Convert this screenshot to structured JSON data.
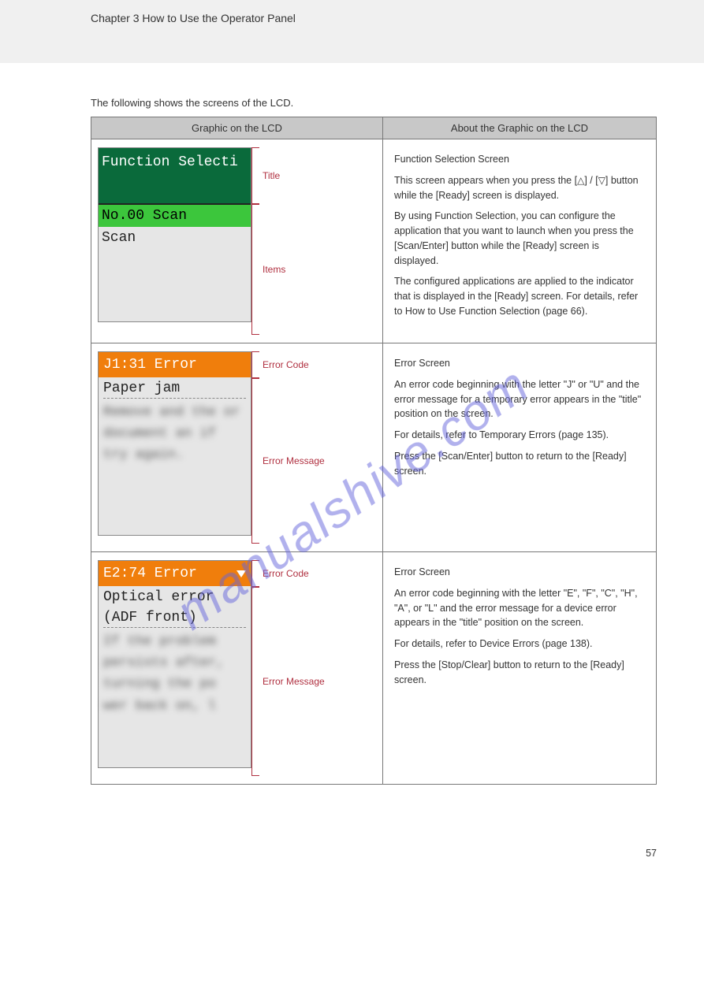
{
  "header_line": "Chapter 3 How to Use the Operator Panel",
  "intro": "The following shows the screens of the LCD.",
  "table": {
    "col1": "Graphic on the LCD",
    "col2": "About the Graphic on the LCD"
  },
  "row1": {
    "title_text": "Function Selecti",
    "selected": "No.00 Scan",
    "body": "Scan",
    "label_title": "Title",
    "label_items": "Items",
    "desc1": "Function Selection Screen",
    "desc2_a": "This screen appears when you press the [",
    "desc2_b": "] / [",
    "desc2_c": "] button while the [Ready] screen is displayed.",
    "desc3": "By using Function Selection, you can configure the application that you want to launch when you press the [Scan/Enter] button while the [Ready] screen is displayed.",
    "desc4_a": "The configured applications are applied to the indicator that is displayed in the [Ready] screen. For details, refer to ",
    "desc4_link": "How to Use Function Selection (page 66)",
    "desc4_b": ".",
    "arrow_up": "△",
    "arrow_down": "▽"
  },
  "row2": {
    "code": "J1:31 Error",
    "msg_head": "Paper jam",
    "blurred": "Remove and the or document an if try again.",
    "label_code": "Error Code",
    "label_msg": "Error Message",
    "desc1": "Error Screen",
    "desc2": "An error code beginning with the letter \"J\" or \"U\" and the error message for a temporary error appears in the \"title\" position on the screen.",
    "desc3_a": "For details, refer to ",
    "desc3_link": "Temporary Errors (page 135)",
    "desc3_b": ".",
    "desc4": "Press the [Scan/Enter] button to return to the [Ready] screen."
  },
  "row3": {
    "code": "E2:74 Error",
    "msg_head1": "Optical error",
    "msg_head2": "(ADF front)",
    "blurred": "If the problem persists after, turning the po wer back on, l",
    "label_code": "Error Code",
    "label_msg": "Error Message",
    "desc1": "Error Screen",
    "desc2": "An error code beginning with the letter \"E\", \"F\", \"C\", \"H\", \"A\", or \"L\" and the error message for a device error appears in the \"title\" position on the screen.",
    "desc3_a": "For details, refer to ",
    "desc3_link": "Device Errors (page 138)",
    "desc3_b": ".",
    "desc4": "Press the [Stop/Clear] button to return to the [Ready] screen."
  },
  "watermark": "manualshive.com",
  "page_number": "57"
}
